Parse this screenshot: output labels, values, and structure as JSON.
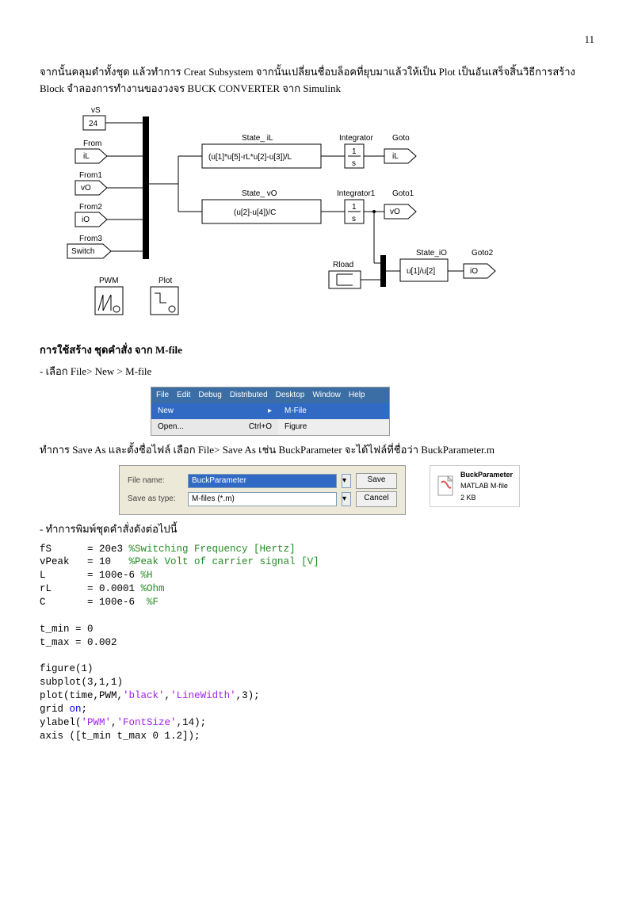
{
  "page_number": "11",
  "para1": "จากนั้นคลุมดำทั้งชุด แล้วทำการ Creat Subsystem จากนั้นเปลี่ยนชื่อบล็อคที่ยุบมาแล้วให้เป็น Plot เป็นอันเสร็จสิ้นวิธีการสร้าง Block จำลองการทำงานของวงจร BUCK CONVERTER จาก Simulink",
  "diagram": {
    "vS": "vS",
    "vS_val": "24",
    "From": "From",
    "iL": "iL",
    "From1": "From1",
    "vO": "vO",
    "From2": "From2",
    "iO": "iO",
    "From3": "From3",
    "Switch": "Switch",
    "PWM": "PWM",
    "Plot": "Plot",
    "State_iL": "State_ iL",
    "State_iL_eq": "(u[1]*u[5]-rL*u[2]-u[3])/L",
    "Integrator": "Integrator",
    "one_s": "1",
    "s": "s",
    "Goto": "Goto",
    "State_vO": "State_ vO",
    "State_vO_eq": "(u[2]-u[4])/C",
    "Integrator1": "Integrator1",
    "Goto1": "Goto1",
    "Rload": "Rload",
    "State_iO": "State_iO",
    "State_iO_eq": "u[1]/u[2]",
    "Goto2": "Goto2"
  },
  "heading_mfile": "การใช้สร้าง ชุดคำสั่ง จาก M-file",
  "step_mfile": "- เลือก File> New > M-file",
  "menu": {
    "items": [
      "File",
      "Edit",
      "Debug",
      "Distributed",
      "Desktop",
      "Window",
      "Help"
    ],
    "new": "New",
    "open": "Open...",
    "open_sc": "Ctrl+O",
    "mfile": "M-File",
    "figure": "Figure"
  },
  "para_saveas": "ทำการ Save As และตั้งชื่อไฟล์  เลือก File> Save As เช่น BuckParameter จะได้ไฟล์ที่ชื่อว่า BuckParameter.m",
  "saveas": {
    "fname_lbl": "File name:",
    "fname_val": "BuckParameter",
    "ftype_lbl": "Save as type:",
    "ftype_val": "M-files (*.m)",
    "save": "Save",
    "cancel": "Cancel",
    "file_name": "BuckParameter",
    "file_sub": "MATLAB M-file",
    "file_sz": "2 KB"
  },
  "step_type": "- ทำการพิมพ์ชุดคำสั่งดังต่อไปนี้",
  "code": {
    "l1a": "fS      = 20e3 ",
    "l1c": "%Switching Frequency [Hertz]",
    "l2a": "vPeak   = 10   ",
    "l2c": "%Peak Volt of carrier signal [V]",
    "l3a": "L       = 100e-6 ",
    "l3c": "%H",
    "l4a": "rL      = 0.0001 ",
    "l4c": "%Ohm",
    "l5a": "C       = 100e-6  ",
    "l5c": "%F",
    "l6": "",
    "l7": "t_min = 0",
    "l8": "t_max = 0.002",
    "l9": "",
    "l10": "figure(1)",
    "l11": "subplot(3,1,1)",
    "l12a": "plot(time,PWM,",
    "l12s1": "'black'",
    "l12b": ",",
    "l12s2": "'LineWidth'",
    "l12c": ",3);",
    "l13a": "grid ",
    "l13k": "on",
    "l13b": ";",
    "l14a": "ylabel(",
    "l14s1": "'PWM'",
    "l14b": ",",
    "l14s2": "'FontSize'",
    "l14c": ",14);",
    "l15": "axis ([t_min t_max 0 1.2]);"
  }
}
